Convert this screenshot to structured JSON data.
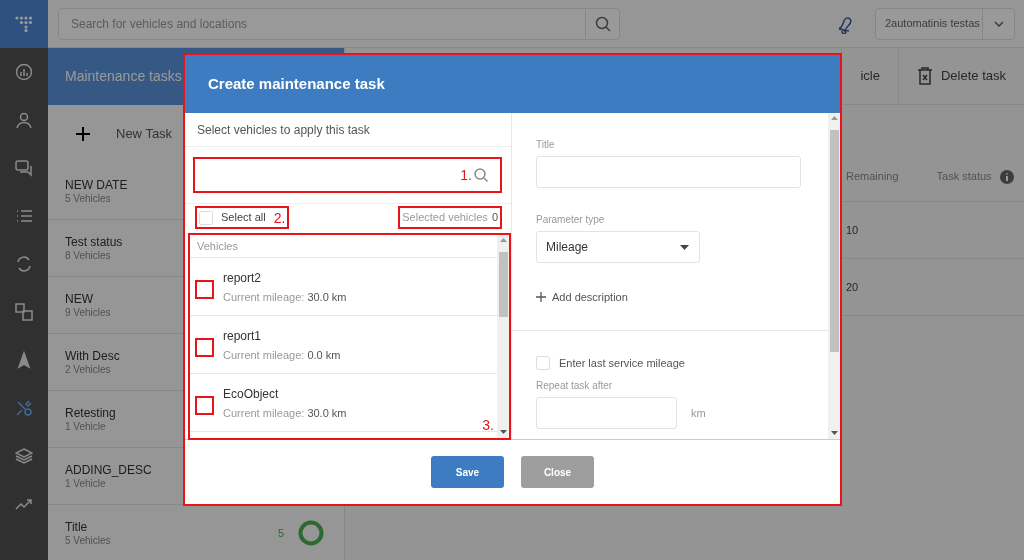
{
  "sidebar": {
    "items": [
      {
        "selected": false
      },
      {
        "selected": false
      },
      {
        "selected": false
      },
      {
        "selected": false
      },
      {
        "selected": false
      },
      {
        "selected": false
      },
      {
        "selected": false
      },
      {
        "selected": true
      },
      {
        "selected": false
      },
      {
        "selected": false
      }
    ]
  },
  "top_bar": {
    "search": {
      "placeholder": "Search for vehicles and locations"
    },
    "user": "2automatinis testas"
  },
  "panel": {
    "title": "Maintenance tasks",
    "new_task": "New Task",
    "tasks": [
      {
        "title": "NEW DATE",
        "subtitle": "5 Vehicles"
      },
      {
        "title": "Test status",
        "subtitle": "8 Vehicles"
      },
      {
        "title": "NEW",
        "subtitle": "9 Vehicles"
      },
      {
        "title": "With Desc",
        "subtitle": "2 Vehicles"
      },
      {
        "title": "Retesting",
        "subtitle": "1 Vehicle"
      },
      {
        "title": "ADDING_DESC",
        "subtitle": "1 Vehicle"
      },
      {
        "title": "Title",
        "subtitle": "5 Vehicles",
        "count": "5"
      }
    ]
  },
  "toolbar": [
    {
      "label": "icle",
      "kind": "partial"
    },
    {
      "label": "Delete task",
      "kind": "delete"
    }
  ],
  "table": {
    "columns": [
      "Remaining",
      "Task status"
    ],
    "rows": [
      {
        "remaining": "10"
      },
      {
        "remaining": "20"
      }
    ]
  },
  "modal": {
    "title": "Create maintenance task",
    "vehicle_panel": {
      "heading": "Select vehicles to apply this task",
      "select_all": {
        "label": "Select all",
        "checked": false
      },
      "selected_label": "Selected vehicles",
      "selected_count": "0",
      "list_header": "Vehicles",
      "vehicles": [
        {
          "name": "report2",
          "mileage_label": "Current mileage:",
          "mileage": "30.0 km",
          "checked": false
        },
        {
          "name": "report1",
          "mileage_label": "Current mileage:",
          "mileage": "0.0 km",
          "checked": false
        },
        {
          "name": "EcoObject",
          "mileage_label": "Current mileage:",
          "mileage": "30.0 km",
          "checked": false
        }
      ]
    },
    "form": {
      "title_label": "Title",
      "parameter_label": "Parameter type",
      "parameter_value": "Mileage",
      "add_description": "Add description",
      "last_service": {
        "label": "Enter last service mileage",
        "checked": false
      },
      "repeat_label": "Repeat task after",
      "unit": "km"
    },
    "buttons": [
      {
        "label": "Save",
        "kind": "primary"
      },
      {
        "label": "Close",
        "kind": "secondary"
      }
    ]
  },
  "annotations": [
    {
      "label": "1."
    },
    {
      "label": "2."
    },
    {
      "label": "3."
    }
  ]
}
